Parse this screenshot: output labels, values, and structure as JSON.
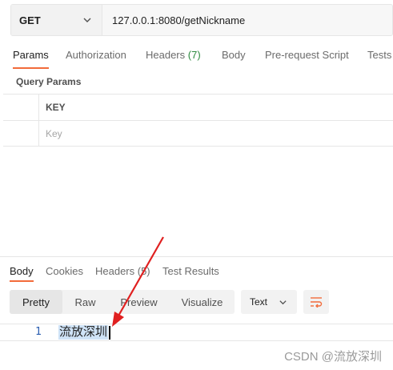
{
  "request": {
    "method": "GET",
    "url": "127.0.0.1:8080/getNickname"
  },
  "request_tabs": [
    {
      "label": "Params",
      "active": true
    },
    {
      "label": "Authorization"
    },
    {
      "label": "Headers",
      "count": "(7)"
    },
    {
      "label": "Body"
    },
    {
      "label": "Pre-request Script"
    },
    {
      "label": "Tests"
    }
  ],
  "query_params": {
    "title": "Query Params",
    "key_header": "KEY",
    "key_placeholder": "Key"
  },
  "response_tabs": [
    {
      "label": "Body",
      "active": true
    },
    {
      "label": "Cookies"
    },
    {
      "label": "Headers (5)"
    },
    {
      "label": "Test Results"
    }
  ],
  "view_modes": [
    "Pretty",
    "Raw",
    "Preview",
    "Visualize"
  ],
  "active_view_mode": "Pretty",
  "format": "Text",
  "response_body": {
    "line_number": "1",
    "content": "流放深圳"
  },
  "watermark": "CSDN @流放深圳",
  "colors": {
    "accent_tab": "#f26b3a",
    "annotation_arrow": "#e02020",
    "selection": "#cfe3f7"
  },
  "icons": {
    "method_dropdown": "chevron-down-icon",
    "format_dropdown": "chevron-down-icon",
    "wrap": "wrap-lines-icon"
  }
}
